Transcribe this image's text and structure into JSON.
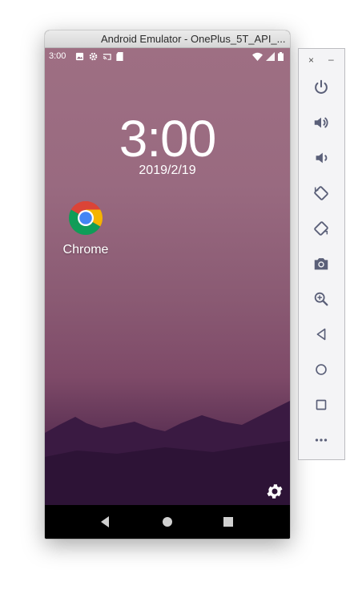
{
  "window": {
    "title": "Android Emulator - OnePlus_5T_API_..."
  },
  "statusbar": {
    "time": "3:00",
    "left_icons": [
      "image-icon",
      "gear-icon",
      "cast-icon",
      "sdcard-icon"
    ],
    "right_icons": [
      "wifi-icon",
      "signal-icon",
      "battery-icon"
    ]
  },
  "lockscreen": {
    "clock": "3:00",
    "date": "2019/2/19"
  },
  "apps": [
    {
      "label": "Chrome",
      "icon": "chrome-icon"
    }
  ],
  "navbar": {
    "buttons": [
      "back-icon",
      "home-icon",
      "recents-icon"
    ]
  },
  "side_panel": {
    "controls": [
      "power-icon",
      "volume-up-icon",
      "volume-down-icon",
      "rotate-left-icon",
      "rotate-right-icon",
      "camera-icon",
      "zoom-icon",
      "back-icon",
      "home-icon",
      "overview-icon",
      "more-icon"
    ],
    "close_glyph": "×",
    "minimize_glyph": "–"
  },
  "colors": {
    "wallpaper_top": "#9e6f83",
    "wallpaper_bottom": "#2a1130",
    "panel_icon": "#5a5f78"
  }
}
